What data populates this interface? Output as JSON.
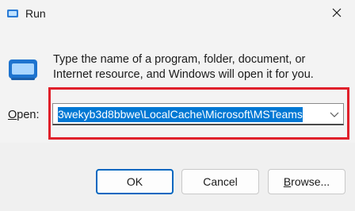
{
  "window": {
    "title": "Run",
    "icons": {
      "app": "run-icon",
      "close": "close-icon"
    }
  },
  "dialog": {
    "description": "Type the name of a program, folder, document, or Internet resource, and Windows will open it for you.",
    "open_label_accel": "O",
    "open_label_rest": "pen:",
    "open_value": "3wekyb3d8bbwe\\LocalCache\\Microsoft\\MSTeams",
    "big_icon": "run-window-icon",
    "dropdown_icon": "chevron-down-icon"
  },
  "buttons": {
    "ok": "OK",
    "cancel": "Cancel",
    "browse_accel": "B",
    "browse_rest": "rowse..."
  },
  "colors": {
    "highlight_box": "#e0202a",
    "selection": "#0078d4",
    "default_button_border": "#0067c0"
  }
}
